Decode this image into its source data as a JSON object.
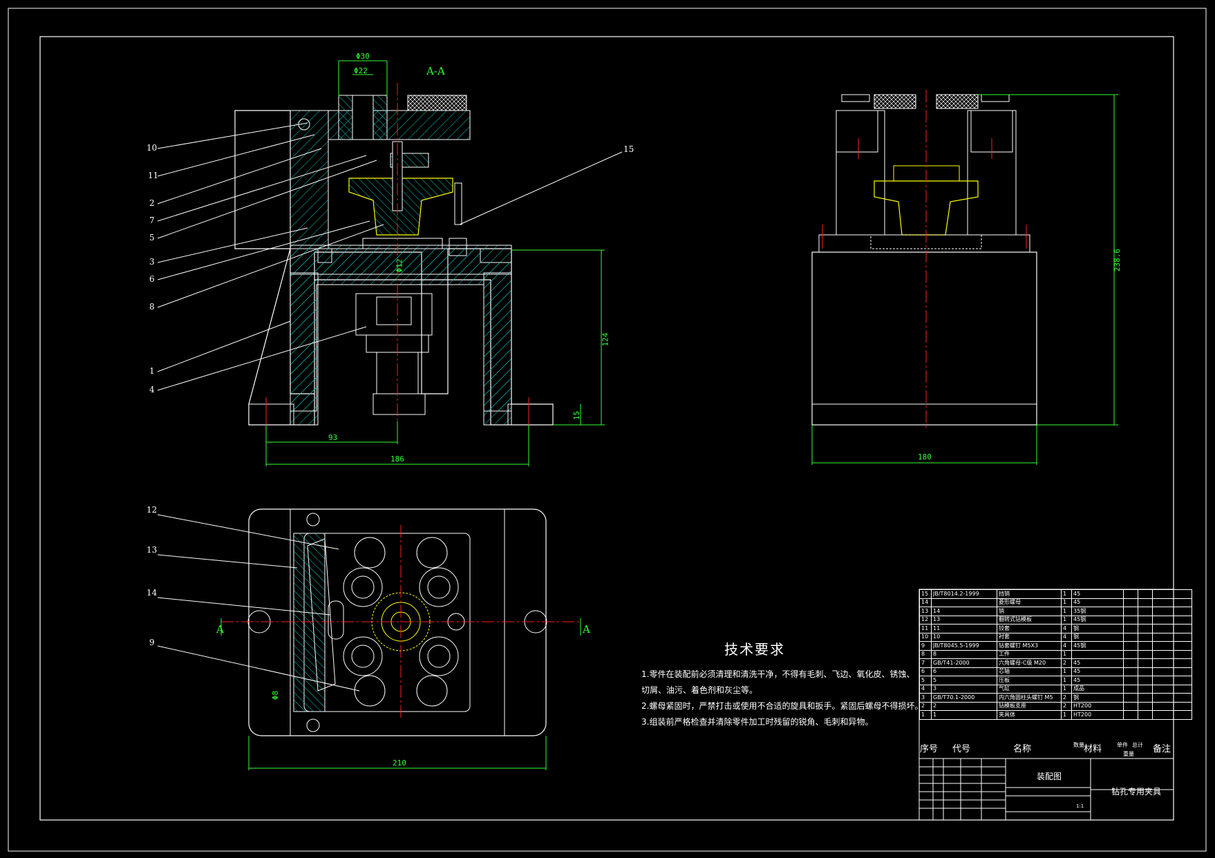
{
  "section_title": "A-A",
  "section_marks": [
    "A",
    "A"
  ],
  "callouts": [
    "10",
    "11",
    "2",
    "7",
    "5",
    "3",
    "6",
    "8",
    "1",
    "4",
    "15",
    "12",
    "13",
    "14",
    "9"
  ],
  "dimensions": {
    "front_width": "186",
    "front_half": "93",
    "front_height": "124",
    "front_base": "15",
    "top_d1": "Φ30",
    "top_d2": "Φ22",
    "inner_d": "Φ12",
    "side_width": "180",
    "side_height": "238.6",
    "plan_width": "210",
    "plan_d": "Φ8"
  },
  "tech_requirements": {
    "title": "技术要求",
    "items": [
      "1.零件在装配前必须清理和清洗干净，不得有毛刺、飞边、氧化皮、锈蚀、",
      "切屑、油污、着色剂和灰尘等。",
      "2.螺母紧固时，严禁打击或使用不合适的旋具和扳手。紧固后螺母不得损坏。",
      "3.组装前严格检查并清除零件加工时残留的锐角、毛刺和异物。"
    ]
  },
  "bom": [
    {
      "no": "15",
      "code": "JB/T8014.2-1999",
      "name": "挡销",
      "qty": "1",
      "material": "45"
    },
    {
      "no": "14",
      "code": "",
      "name": "菱形螺母",
      "qty": "1",
      "material": "45"
    },
    {
      "no": "13",
      "code": "14",
      "name": "销",
      "qty": "1",
      "material": "35钢"
    },
    {
      "no": "12",
      "code": "13",
      "name": "翻转式钻模板",
      "qty": "1",
      "material": "45钢"
    },
    {
      "no": "11",
      "code": "11",
      "name": "铰套",
      "qty": "4",
      "material": "钢"
    },
    {
      "no": "10",
      "code": "10",
      "name": "衬套",
      "qty": "4",
      "material": "钢"
    },
    {
      "no": "9",
      "code": "JB/T8045.5-1999",
      "name": "钻套螺钉 M5X3",
      "qty": "4",
      "material": "45钢"
    },
    {
      "no": "8",
      "code": "8",
      "name": "工件",
      "qty": "1",
      "material": ""
    },
    {
      "no": "7",
      "code": "GB/T41-2000",
      "name": "六角螺母-C级 M20",
      "qty": "2",
      "material": "45"
    },
    {
      "no": "6",
      "code": "6",
      "name": "芯轴",
      "qty": "1",
      "material": "45"
    },
    {
      "no": "5",
      "code": "5",
      "name": "压板",
      "qty": "1",
      "material": "45"
    },
    {
      "no": "4",
      "code": "3",
      "name": "气缸",
      "qty": "1",
      "material": "成品"
    },
    {
      "no": "3",
      "code": "GB/T70.1-2000",
      "name": "内六角圆柱头螺钉 M5",
      "qty": "2",
      "material": "钢"
    },
    {
      "no": "2",
      "code": "2",
      "name": "钻模板支座",
      "qty": "2",
      "material": "HT200"
    },
    {
      "no": "1",
      "code": "1",
      "name": "夹具体",
      "qty": "1",
      "material": "HT200"
    }
  ],
  "bom_header": {
    "no": "序号",
    "code": "代号",
    "name": "名称",
    "qty": "数量",
    "material": "材料",
    "single": "单件",
    "total": "总计",
    "weight": "重量",
    "remark": "备注"
  },
  "title_block": {
    "drawing_name": "装配图",
    "product": "钻孔专用夹具",
    "scale": "1:1"
  },
  "colors": {
    "background": "#000000",
    "line": "#ffffff",
    "hatch": "#00cccc",
    "center": "#ff2020",
    "dimension": "#33ff33",
    "highlight": "#ffff00",
    "frame": "#ffffff"
  }
}
